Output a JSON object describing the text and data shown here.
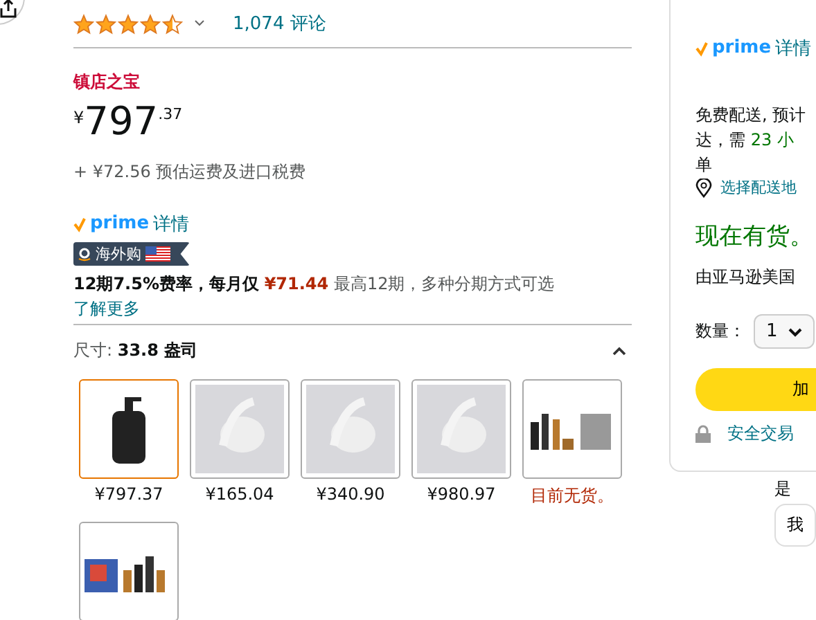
{
  "rating": {
    "stars": 4.5,
    "count": "1,074 评论"
  },
  "badge": "镇店之宝",
  "price": {
    "currency": "¥",
    "whole": "797",
    "fraction": ".37"
  },
  "shipping": "+ ¥72.56 预估运费及进口税费",
  "prime": {
    "logo": "prime",
    "details": "详情"
  },
  "global_tag": "海外购",
  "installment": {
    "text": "**12期7.5%费率，每月仅** ",
    "amount": "¥71.44",
    "note": " 最高12期，多种分期方式可选",
    "link": "了解更多"
  },
  "size": {
    "label": "尺寸: ",
    "value": "33.8 盎司",
    "expanded": true
  },
  "options": [
    {
      "kind": "bottle",
      "price": "¥797.37",
      "selected": true
    },
    {
      "kind": "gel",
      "price": "¥165.04",
      "selected": false
    },
    {
      "kind": "gel",
      "price": "¥340.90",
      "selected": false
    },
    {
      "kind": "gel",
      "price": "¥980.97",
      "selected": false
    },
    {
      "kind": "set",
      "unavailable_note": "目前无货。",
      "selected": false
    },
    {
      "kind": "giftset",
      "selected": false
    }
  ],
  "buy_box": {
    "prime_logo": "prime",
    "prime_details": "详情",
    "delivery_line1": "免费配送, 预计",
    "delivery_line2": "达，需 ",
    "delivery_time": "23 小",
    "delivery_line3": "单",
    "address_link": "选择配送地",
    "stock": "现在有货。",
    "seller": "由亚马逊美国",
    "quantity_label": "数量：",
    "quantity": "1",
    "add_button": "加",
    "secure": "安全交易",
    "below_text": "是",
    "below_button": "我"
  }
}
